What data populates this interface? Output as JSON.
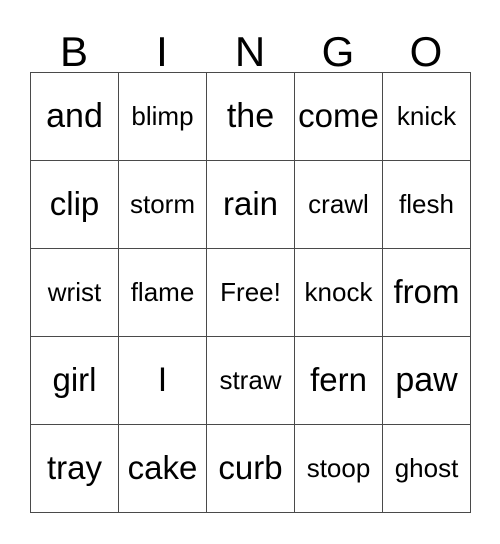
{
  "card": {
    "type": "bingo-card",
    "header": [
      "B",
      "I",
      "N",
      "G",
      "O"
    ],
    "rows": [
      [
        "and",
        "blimp",
        "the",
        "come",
        "knick"
      ],
      [
        "clip",
        "storm",
        "rain",
        "crawl",
        "flesh"
      ],
      [
        "wrist",
        "flame",
        "Free!",
        "knock",
        "from"
      ],
      [
        "girl",
        "I",
        "straw",
        "fern",
        "paw"
      ],
      [
        "tray",
        "cake",
        "curb",
        "stoop",
        "ghost"
      ]
    ],
    "free_space": {
      "row": 2,
      "column": 2,
      "label": "Free!"
    },
    "colors": {
      "background": "#ffffff",
      "text": "#000000",
      "grid_line": "#4a4a4a"
    }
  }
}
